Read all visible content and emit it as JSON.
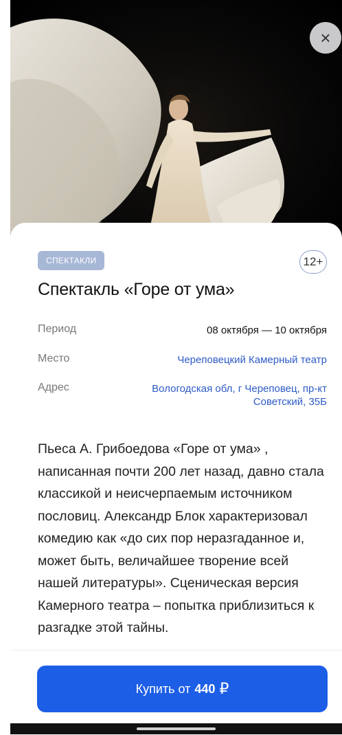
{
  "close": {
    "icon": "close-icon",
    "symbol": "×"
  },
  "event": {
    "category": "СПЕКТАКЛИ",
    "age_rating": "12+",
    "title": "Спектакль «Горе от ума»"
  },
  "info": {
    "period_label": "Период",
    "period_value": "08 октября — 10 октября",
    "place_label": "Место",
    "place_value": "Череповецкий Камерный театр",
    "address_label": "Адрес",
    "address_value": "Вологодская обл, г Череповец, пр-кт Советский, 35Б"
  },
  "description": "Пьеса А. Грибоедова «Горе от ума» , написанная почти 200 лет назад, давно стала классикой и неисчерпаемым источником пословиц. Александр Блок характеризовал комедию как «до сих пор неразгаданное и, может быть, величайшее творение всей нашей литературы». Сценическая версия Камерного театра – попытка приблизиться к разгадке этой тайны.",
  "buy": {
    "prefix": "Купить от",
    "price": "440",
    "currency": "₽"
  },
  "colors": {
    "accent": "#1c5ee6",
    "tag_bg": "#a7b7d6",
    "link": "#2e5bc6"
  }
}
